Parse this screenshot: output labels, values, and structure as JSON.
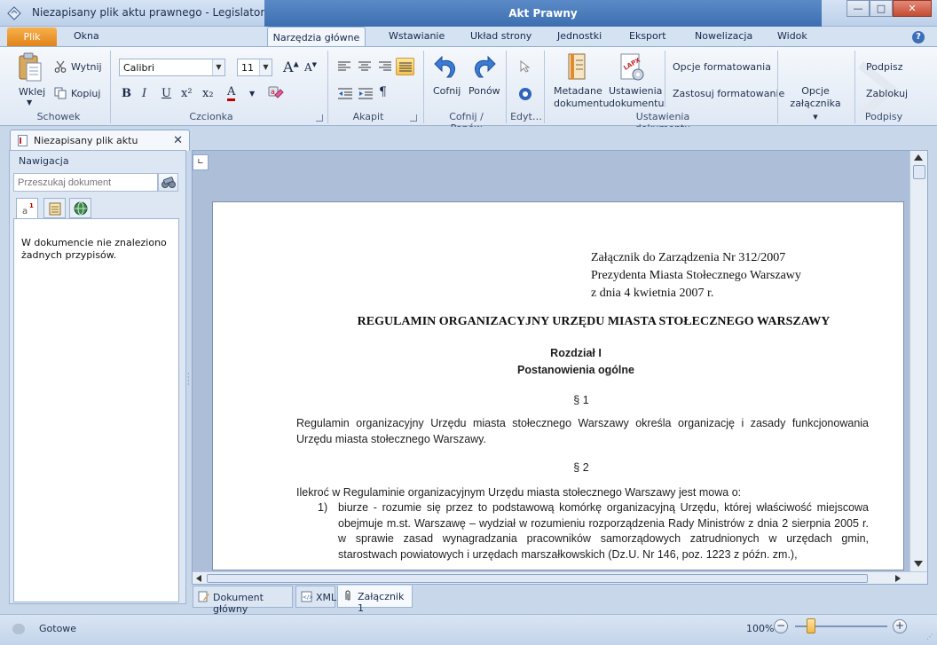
{
  "window": {
    "document_title": "Niezapisany plik aktu prawnego - Legislator",
    "context_title": "Akt Prawny",
    "controls": {
      "minimize": "—",
      "maximize": "□",
      "close": "✕"
    }
  },
  "menu": {
    "file": "Plik",
    "tabs": [
      "Okna",
      "Narzędzia główne",
      "Wstawianie",
      "Układ strony",
      "Jednostki",
      "Eksport",
      "Nowelizacja",
      "Widok"
    ],
    "help": "?"
  },
  "ribbon": {
    "clipboard": {
      "paste": "Wklej",
      "cut": "Wytnij",
      "copy": "Kopiuj",
      "group": "Schowek"
    },
    "font": {
      "family": "Calibri",
      "size": "11",
      "bold": "B",
      "italic": "I",
      "underline": "U",
      "superscript": "x²",
      "subscript": "x₂",
      "color": "A",
      "group": "Czcionka"
    },
    "paragraph": {
      "group": "Akapit",
      "pilcrow": "¶"
    },
    "undo": {
      "undo": "Cofnij",
      "redo": "Ponów",
      "group": "Cofnij / Ponów"
    },
    "edit": {
      "group": "Edyt…"
    },
    "doc_settings": {
      "metadata_l1": "Metadane",
      "metadata_l2": "dokumentu",
      "settings_l1": "Ustawienia",
      "settings_l2": "dokumentu",
      "format_options": "Opcje formatowania",
      "apply_format": "Zastosuj formatowanie",
      "group": "Ustawienia dokumentu"
    },
    "attachment": {
      "l1": "Opcje",
      "l2": "załącznika"
    },
    "signatures": {
      "sign": "Podpisz",
      "lock": "Zablokuj",
      "group": "Podpisy"
    }
  },
  "doc_tab": {
    "label": "Niezapisany plik aktu prawnego",
    "close": "✕"
  },
  "navigation": {
    "title": "Nawigacja",
    "search_placeholder": "Przeszukaj dokument",
    "empty_message": "W dokumencie nie znaleziono żadnych przypisów."
  },
  "document": {
    "annex_lines": [
      "Załącznik do Zarządzenia Nr 312/2007",
      "Prezydenta Miasta Stołecznego Warszawy",
      "z dnia 4 kwietnia 2007 r."
    ],
    "title": "REGULAMIN ORGANIZACYJNY URZĘDU MIASTA STOŁECZNEGO WARSZAWY",
    "chapter": "Rozdział I",
    "chapter_title": "Postanowienia ogólne",
    "p1_sign": "§ 1",
    "p1_text": "Regulamin organizacyjny Urzędu miasta stołecznego Warszawy określa organizację i zasady funkcjonowania Urzędu miasta stołecznego Warszawy.",
    "p2_sign": "§ 2",
    "p2_intro": "Ilekroć w Regulaminie organizacyjnym Urzędu miasta stołecznego Warszawy jest mowa o:",
    "item1_num": "1)",
    "item1_text": "biurze - rozumie się przez to podstawową komórkę organizacyjną Urzędu, której właściwość miejscowa obejmuje m.st. Warszawę – wydział w rozumieniu rozporządzenia Rady Ministrów z dnia 2 sierpnia 2005 r. w sprawie zasad wynagradzania pracowników samorządowych zatrudnionych w urzędach gmin, starostwach powiatowych i urzędach marszałkowskich (Dz.U. Nr 146, poz. 1223 z późn. zm.),"
  },
  "bottom_tabs": [
    "Dokument główny",
    "XML",
    "Załącznik 1"
  ],
  "status": {
    "text": "Gotowe",
    "zoom": "100%",
    "zoom_out": "−",
    "zoom_in": "+"
  }
}
